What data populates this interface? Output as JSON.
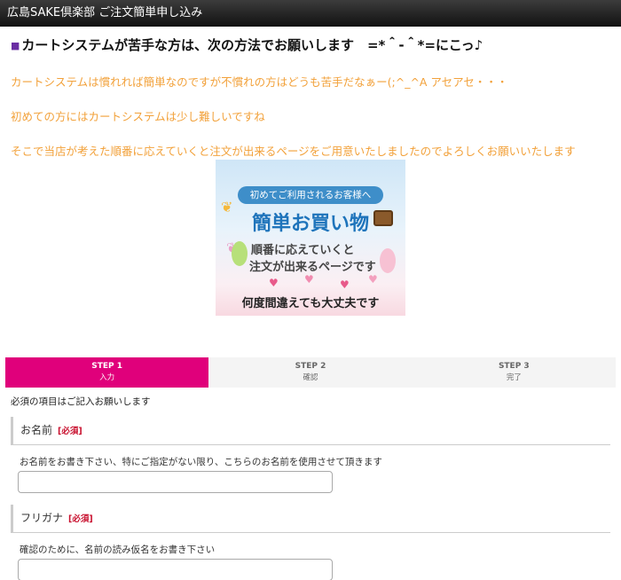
{
  "header": {
    "title": "広島SAKE倶楽部 ご注文簡単申し込み"
  },
  "intro": {
    "headline": "カートシステムが苦手な方は、次の方法でお願いします　=*＾-＾*=にこっ♪",
    "lines": [
      "カートシステムは慣れれば簡単なのですが不慣れの方はどうも苦手だなぁー(;^_^A アセアセ・・・",
      "初めての方にはカートシステムは少し難しいですね",
      "そこで当店が考えた順番に応えていくと注文が出来るページをご用意いたしましたのでよろしくお願いいたします"
    ]
  },
  "banner": {
    "pill": "初めてご利用されるお客様へ",
    "title": "簡単お買い物",
    "line1": "順番に応えていくと",
    "line2": "注文が出来るページです",
    "bottom": "何度間違えても大丈夫です"
  },
  "steps": [
    {
      "label": "STEP 1",
      "sub": "入力",
      "active": true
    },
    {
      "label": "STEP 2",
      "sub": "確認",
      "active": false
    },
    {
      "label": "STEP 3",
      "sub": "完了",
      "active": false
    }
  ],
  "form": {
    "required_note": "必須の項目はご記入お願いします",
    "sections": [
      {
        "label": "お名前",
        "required": "[必須]",
        "description": "お名前をお書き下さい、特にご指定がない限り、こちらのお名前を使用させて頂きます",
        "value": ""
      },
      {
        "label": "フリガナ",
        "required": "[必須]",
        "description": "確認のために、名前の読み仮名をお書き下さい",
        "value": ""
      }
    ]
  },
  "colors": {
    "step_active": "#e0007b",
    "intro_text": "#f2a13a",
    "required": "#c8102e"
  }
}
